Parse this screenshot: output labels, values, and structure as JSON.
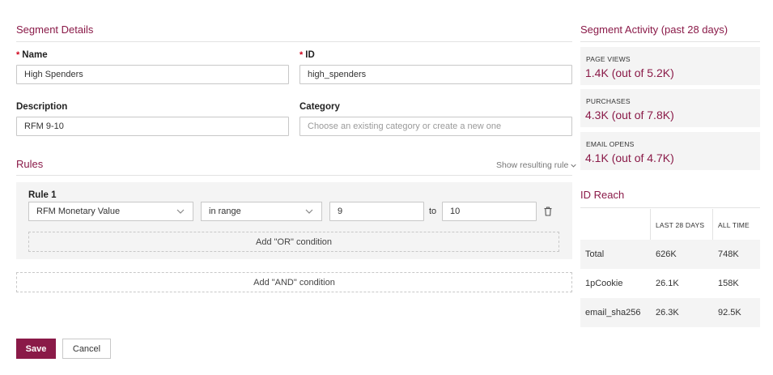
{
  "segment_details": {
    "title": "Segment Details",
    "name_label": "Name",
    "name_value": "High Spenders",
    "id_label": "ID",
    "id_value": "high_spenders",
    "description_label": "Description",
    "description_value": "RFM 9-10",
    "category_label": "Category",
    "category_placeholder": "Choose an existing category or create a new one",
    "required_mark": "*"
  },
  "rules": {
    "title": "Rules",
    "show_resulting_rule": "Show resulting rule",
    "rule_title": "Rule 1",
    "field_value": "RFM Monetary Value",
    "operator_value": "in range",
    "range_from": "9",
    "to_label": "to",
    "range_to": "10",
    "add_or_label": "Add \"OR\" condition",
    "add_and_label": "Add \"AND\" condition"
  },
  "actions": {
    "save_label": "Save",
    "cancel_label": "Cancel"
  },
  "activity": {
    "title": "Segment Activity (past 28 days)",
    "stats": [
      {
        "label": "PAGE VIEWS",
        "value": "1.4K (out of 5.2K)"
      },
      {
        "label": "PURCHASES",
        "value": "4.3K (out of 7.8K)"
      },
      {
        "label": "EMAIL OPENS",
        "value": "4.1K (out of 4.7K)"
      }
    ]
  },
  "id_reach": {
    "title": "ID Reach",
    "columns": [
      "",
      "LAST 28 DAYS",
      "ALL TIME"
    ],
    "rows": [
      {
        "name": "Total",
        "last28": "626K",
        "alltime": "748K"
      },
      {
        "name": "1pCookie",
        "last28": "26.1K",
        "alltime": "158K"
      },
      {
        "name": "email_sha256",
        "last28": "26.3K",
        "alltime": "92.5K"
      }
    ]
  },
  "colors": {
    "accent": "#8a1a48",
    "panel": "#f4f4f4",
    "required": "#d0021b"
  }
}
